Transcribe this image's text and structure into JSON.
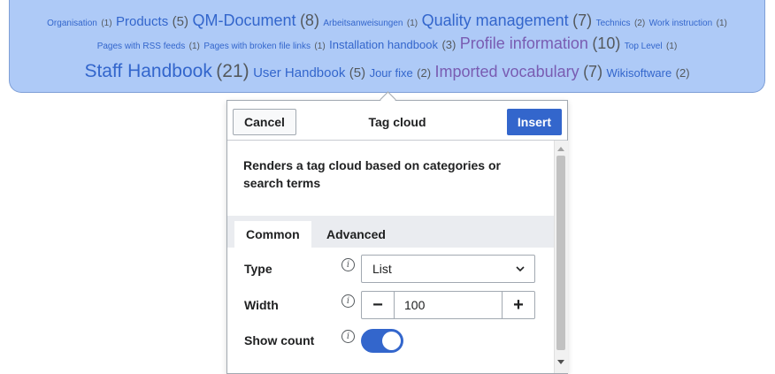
{
  "cloud": {
    "line1": [
      {
        "name": "Organisation",
        "count": "(1)",
        "size": "xs"
      },
      {
        "name": "Products",
        "count": "(5)",
        "size": "m"
      },
      {
        "name": "QM-Document",
        "count": "(8)",
        "size": "l"
      },
      {
        "name": "Arbeitsanweisungen",
        "count": "(1)",
        "size": "xs"
      },
      {
        "name": "Quality management",
        "count": "(7)",
        "size": "l"
      },
      {
        "name": "Technics",
        "count": "(2)",
        "size": "xs"
      },
      {
        "name": "Work instruction",
        "count": "(1)",
        "size": "xs"
      }
    ],
    "line2": [
      {
        "name": "Pages with RSS feeds",
        "count": "(1)",
        "size": "xs"
      },
      {
        "name": "Pages with broken file links",
        "count": "(1)",
        "size": "xs"
      },
      {
        "name": "Installation handbook",
        "count": "(3)",
        "size": "s"
      },
      {
        "name": "Profile information",
        "count": "(10)",
        "size": "l",
        "visited": true
      },
      {
        "name": "Top Level",
        "count": "(1)",
        "size": "xs"
      }
    ],
    "line3": [
      {
        "name": "Staff Handbook",
        "count": "(21)",
        "size": "xl"
      },
      {
        "name": "User Handbook",
        "count": "(5)",
        "size": "m"
      },
      {
        "name": "Jour fixe",
        "count": "(2)",
        "size": "s"
      },
      {
        "name": "Imported vocabulary",
        "count": "(7)",
        "size": "l",
        "visited": true
      },
      {
        "name": "Wikisoftware",
        "count": "(2)",
        "size": "s"
      }
    ]
  },
  "dialog": {
    "cancel_label": "Cancel",
    "title": "Tag cloud",
    "insert_label": "Insert",
    "description": "Renders a tag cloud based on categories or search terms",
    "tabs": [
      {
        "label": "Common"
      },
      {
        "label": "Advanced"
      }
    ],
    "fields": {
      "type": {
        "label": "Type",
        "value": "List"
      },
      "width": {
        "label": "Width",
        "value": "100",
        "minus": "−",
        "plus": "+"
      },
      "show_count": {
        "label": "Show count",
        "on": true
      }
    },
    "info_glyph": "i"
  },
  "colors": {
    "accent": "#3366cc",
    "cloud_bg": "#aecaf7",
    "visited": "#795cb2"
  }
}
